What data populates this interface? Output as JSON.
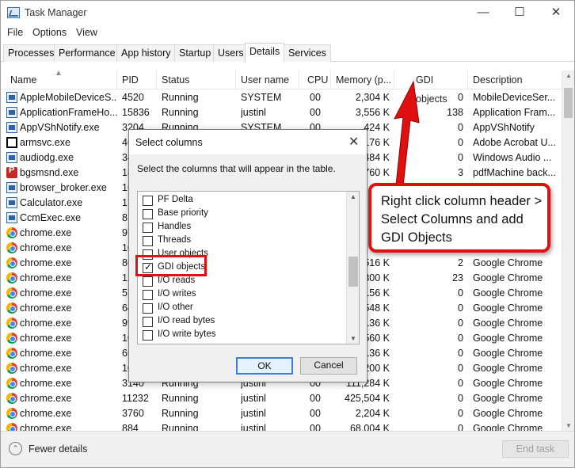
{
  "window": {
    "title": "Task Manager"
  },
  "titlebar": {
    "minimize": "—",
    "maximize": "☐",
    "close": "✕"
  },
  "menu": [
    "File",
    "Options",
    "View"
  ],
  "tabs": [
    "Processes",
    "Performance",
    "App history",
    "Startup",
    "Users",
    "Details",
    "Services"
  ],
  "columns": [
    "Name",
    "PID",
    "Status",
    "User name",
    "CPU",
    "Memory (p...",
    "GDI objects",
    "Description"
  ],
  "rows": [
    {
      "icon": "window-icon",
      "name": "AppleMobileDeviceS...",
      "pid": "4520",
      "status": "Running",
      "user": "SYSTEM",
      "cpu": "00",
      "memory": "2,304 K",
      "gdi": "0",
      "desc": "MobileDeviceSer..."
    },
    {
      "icon": "window-icon",
      "name": "ApplicationFrameHo...",
      "pid": "15836",
      "status": "Running",
      "user": "justinl",
      "cpu": "00",
      "memory": "3,556 K",
      "gdi": "138",
      "desc": "Application Fram..."
    },
    {
      "icon": "window-icon",
      "name": "AppVShNotify.exe",
      "pid": "3204",
      "status": "Running",
      "user": "SYSTEM",
      "cpu": "00",
      "memory": "424 K",
      "gdi": "0",
      "desc": "AppVShNotify"
    },
    {
      "icon": "black-window-icon",
      "name": "armsvc.exe",
      "pid": "46",
      "status": "",
      "user": "",
      "cpu": "",
      "memory": "176 K",
      "gdi": "0",
      "desc": "Adobe Acrobat U..."
    },
    {
      "icon": "window-icon",
      "name": "audiodg.exe",
      "pid": "34",
      "status": "",
      "user": "",
      "cpu": "",
      "memory": "484 K",
      "gdi": "0",
      "desc": "Windows Audio ..."
    },
    {
      "icon": "pdf-red-icon",
      "name": "bgsmsnd.exe",
      "pid": "18",
      "status": "",
      "user": "",
      "cpu": "",
      "memory": "760 K",
      "gdi": "3",
      "desc": "pdfMachine back..."
    },
    {
      "icon": "window-icon",
      "name": "browser_broker.exe",
      "pid": "16",
      "status": "",
      "user": "",
      "cpu": "",
      "memory": "",
      "gdi": "",
      "desc": ""
    },
    {
      "icon": "window-icon",
      "name": "Calculator.exe",
      "pid": "17",
      "status": "",
      "user": "",
      "cpu": "",
      "memory": "",
      "gdi": "",
      "desc": ""
    },
    {
      "icon": "window-icon",
      "name": "CcmExec.exe",
      "pid": "8",
      "status": "",
      "user": "",
      "cpu": "",
      "memory": "",
      "gdi": "",
      "desc": ""
    },
    {
      "icon": "chrome-icon",
      "name": "chrome.exe",
      "pid": "97",
      "status": "",
      "user": "",
      "cpu": "",
      "memory": "",
      "gdi": "",
      "desc": ""
    },
    {
      "icon": "chrome-icon",
      "name": "chrome.exe",
      "pid": "10",
      "status": "",
      "user": "",
      "cpu": "",
      "memory": "",
      "gdi": "",
      "desc": ""
    },
    {
      "icon": "chrome-icon",
      "name": "chrome.exe",
      "pid": "86",
      "status": "",
      "user": "",
      "cpu": "",
      "memory": "516 K",
      "gdi": "2",
      "desc": "Google Chrome"
    },
    {
      "icon": "chrome-icon",
      "name": "chrome.exe",
      "pid": "12",
      "status": "",
      "user": "",
      "cpu": "",
      "memory": "300 K",
      "gdi": "23",
      "desc": "Google Chrome"
    },
    {
      "icon": "chrome-icon",
      "name": "chrome.exe",
      "pid": "57",
      "status": "",
      "user": "",
      "cpu": "",
      "memory": "156 K",
      "gdi": "0",
      "desc": "Google Chrome"
    },
    {
      "icon": "chrome-icon",
      "name": "chrome.exe",
      "pid": "64",
      "status": "",
      "user": "",
      "cpu": "",
      "memory": "548 K",
      "gdi": "0",
      "desc": "Google Chrome"
    },
    {
      "icon": "chrome-icon",
      "name": "chrome.exe",
      "pid": "99",
      "status": "",
      "user": "",
      "cpu": "",
      "memory": "136 K",
      "gdi": "0",
      "desc": "Google Chrome"
    },
    {
      "icon": "chrome-icon",
      "name": "chrome.exe",
      "pid": "10",
      "status": "",
      "user": "",
      "cpu": "",
      "memory": "560 K",
      "gdi": "0",
      "desc": "Google Chrome"
    },
    {
      "icon": "chrome-icon",
      "name": "chrome.exe",
      "pid": "65",
      "status": "",
      "user": "",
      "cpu": "",
      "memory": "136 K",
      "gdi": "0",
      "desc": "Google Chrome"
    },
    {
      "icon": "chrome-icon",
      "name": "chrome.exe",
      "pid": "10",
      "status": "",
      "user": "",
      "cpu": "",
      "memory": "200 K",
      "gdi": "0",
      "desc": "Google Chrome"
    },
    {
      "icon": "chrome-icon",
      "name": "chrome.exe",
      "pid": "3140",
      "status": "Running",
      "user": "justinl",
      "cpu": "00",
      "memory": "111,284 K",
      "gdi": "0",
      "desc": "Google Chrome"
    },
    {
      "icon": "chrome-icon",
      "name": "chrome.exe",
      "pid": "11232",
      "status": "Running",
      "user": "justinl",
      "cpu": "00",
      "memory": "425,504 K",
      "gdi": "0",
      "desc": "Google Chrome"
    },
    {
      "icon": "chrome-icon",
      "name": "chrome.exe",
      "pid": "3760",
      "status": "Running",
      "user": "justinl",
      "cpu": "00",
      "memory": "2,204 K",
      "gdi": "0",
      "desc": "Google Chrome"
    },
    {
      "icon": "chrome-icon",
      "name": "chrome.exe",
      "pid": "884",
      "status": "Running",
      "user": "justinl",
      "cpu": "00",
      "memory": "68,004 K",
      "gdi": "0",
      "desc": "Google Chrome"
    }
  ],
  "footer": {
    "fewer_details": "Fewer details",
    "end_task": "End task"
  },
  "dialog": {
    "title": "Select columns",
    "instruction": "Select the columns that will appear in the table.",
    "options": [
      {
        "label": "PF Delta",
        "checked": false
      },
      {
        "label": "Base priority",
        "checked": false
      },
      {
        "label": "Handles",
        "checked": false
      },
      {
        "label": "Threads",
        "checked": false
      },
      {
        "label": "User objects",
        "checked": false
      },
      {
        "label": "GDI objects",
        "checked": true
      },
      {
        "label": "I/O reads",
        "checked": false
      },
      {
        "label": "I/O writes",
        "checked": false
      },
      {
        "label": "I/O other",
        "checked": false
      },
      {
        "label": "I/O read bytes",
        "checked": false
      },
      {
        "label": "I/O write bytes",
        "checked": false
      }
    ],
    "ok": "OK",
    "cancel": "Cancel"
  },
  "callout": {
    "text": "Right click column header > Select Columns and add GDI Objects"
  },
  "colors": {
    "annotation_red": "#e01010",
    "accent_blue": "#3c7fd6"
  }
}
